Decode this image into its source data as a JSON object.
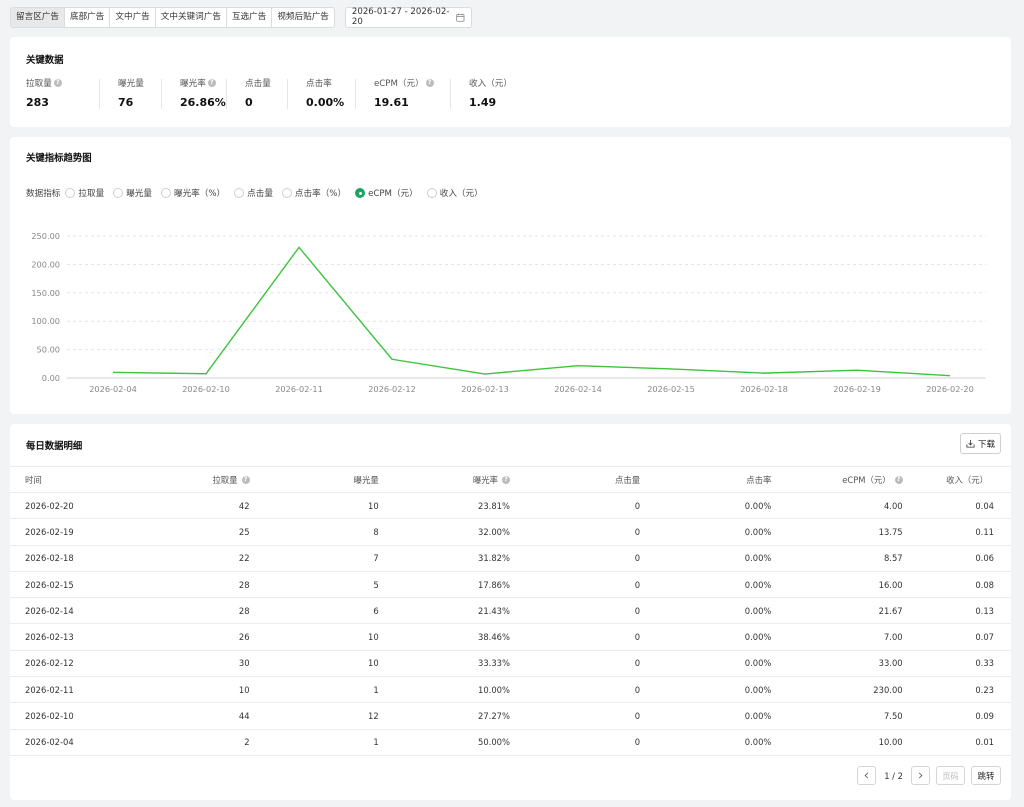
{
  "tabs": [
    "留言区广告",
    "底部广告",
    "文中广告",
    "文中关键词广告",
    "互选广告",
    "视频后贴广告"
  ],
  "active_tab": 0,
  "date_range": "2026-01-27 - 2026-02-20",
  "key_data": {
    "title": "关键数据",
    "metrics": [
      {
        "label": "拉取量",
        "value": "283",
        "help": true
      },
      {
        "label": "曝光量",
        "value": "76",
        "help": false
      },
      {
        "label": "曝光率",
        "value": "26.86%",
        "help": true
      },
      {
        "label": "点击量",
        "value": "0",
        "help": false
      },
      {
        "label": "点击率",
        "value": "0.00%",
        "help": false
      },
      {
        "label": "eCPM（元）",
        "value": "19.61",
        "help": true
      },
      {
        "label": "收入（元）",
        "value": "1.49",
        "help": false
      }
    ]
  },
  "trend": {
    "title": "关键指标趋势图",
    "indicator_label": "数据指标",
    "options": [
      "拉取量",
      "曝光量",
      "曝光率（%）",
      "点击量",
      "点击率（%）",
      "eCPM（元）",
      "收入（元）"
    ],
    "selected": 5
  },
  "chart_data": {
    "type": "line",
    "categories": [
      "2026-02-04",
      "2026-02-10",
      "2026-02-11",
      "2026-02-12",
      "2026-02-13",
      "2026-02-14",
      "2026-02-15",
      "2026-02-18",
      "2026-02-19",
      "2026-02-20"
    ],
    "series": [
      {
        "values": [
          10.0,
          7.5,
          230.0,
          33.0,
          7.0,
          21.67,
          16.0,
          8.57,
          13.75,
          4.0
        ]
      }
    ],
    "y_ticks": [
      "0.00",
      "50.00",
      "100.00",
      "150.00",
      "200.00",
      "250.00"
    ],
    "ylim": [
      0,
      250
    ],
    "grid": true,
    "line_color": "#3cc43c"
  },
  "table": {
    "title": "每日数据明细",
    "download_label": "下载",
    "columns": [
      {
        "label": "时间",
        "help": false
      },
      {
        "label": "拉取量",
        "help": true
      },
      {
        "label": "曝光量",
        "help": false
      },
      {
        "label": "曝光率",
        "help": true
      },
      {
        "label": "点击量",
        "help": false
      },
      {
        "label": "点击率",
        "help": false
      },
      {
        "label": "eCPM（元）",
        "help": true
      },
      {
        "label": "收入（元）",
        "help": false
      }
    ],
    "rows": [
      [
        "2026-02-20",
        "42",
        "10",
        "23.81%",
        "0",
        "0.00%",
        "4.00",
        "0.04"
      ],
      [
        "2026-02-19",
        "25",
        "8",
        "32.00%",
        "0",
        "0.00%",
        "13.75",
        "0.11"
      ],
      [
        "2026-02-18",
        "22",
        "7",
        "31.82%",
        "0",
        "0.00%",
        "8.57",
        "0.06"
      ],
      [
        "2026-02-15",
        "28",
        "5",
        "17.86%",
        "0",
        "0.00%",
        "16.00",
        "0.08"
      ],
      [
        "2026-02-14",
        "28",
        "6",
        "21.43%",
        "0",
        "0.00%",
        "21.67",
        "0.13"
      ],
      [
        "2026-02-13",
        "26",
        "10",
        "38.46%",
        "0",
        "0.00%",
        "7.00",
        "0.07"
      ],
      [
        "2026-02-12",
        "30",
        "10",
        "33.33%",
        "0",
        "0.00%",
        "33.00",
        "0.33"
      ],
      [
        "2026-02-11",
        "10",
        "1",
        "10.00%",
        "0",
        "0.00%",
        "230.00",
        "0.23"
      ],
      [
        "2026-02-10",
        "44",
        "12",
        "27.27%",
        "0",
        "0.00%",
        "7.50",
        "0.09"
      ],
      [
        "2026-02-04",
        "2",
        "1",
        "50.00%",
        "0",
        "0.00%",
        "10.00",
        "0.01"
      ]
    ]
  },
  "pager": {
    "info": "1 / 2",
    "page_placeholder": "页码",
    "jump_label": "跳转"
  }
}
